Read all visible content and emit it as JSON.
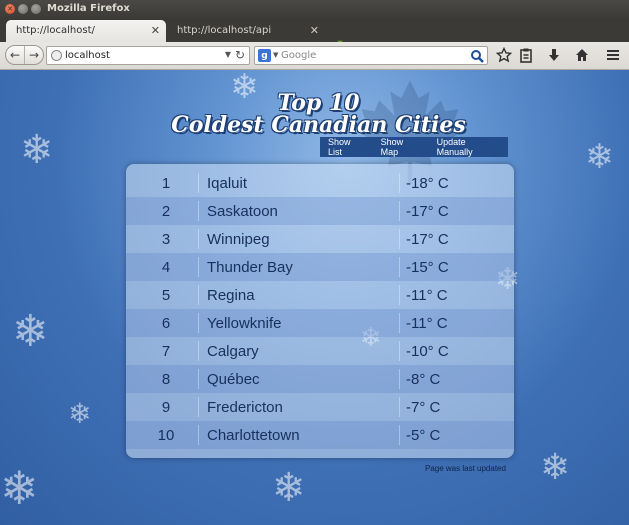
{
  "window": {
    "title": "Mozilla Firefox"
  },
  "tabs": [
    {
      "label": "http://localhost/",
      "active": true
    },
    {
      "label": "http://localhost/api",
      "active": false
    }
  ],
  "navbar": {
    "url": "localhost",
    "search_placeholder": "Google"
  },
  "page": {
    "title_line1": "Top 10",
    "title_line2": "Coldest Canadian Cities",
    "actions": [
      "Show List",
      "Show Map",
      "Update Manually"
    ],
    "cities": [
      {
        "rank": "1",
        "name": "Iqaluit",
        "temp": "-18° C"
      },
      {
        "rank": "2",
        "name": "Saskatoon",
        "temp": "-17° C"
      },
      {
        "rank": "3",
        "name": "Winnipeg",
        "temp": "-17° C"
      },
      {
        "rank": "4",
        "name": "Thunder Bay",
        "temp": "-15° C"
      },
      {
        "rank": "5",
        "name": "Regina",
        "temp": "-11° C"
      },
      {
        "rank": "6",
        "name": "Yellowknife",
        "temp": "-11° C"
      },
      {
        "rank": "7",
        "name": "Calgary",
        "temp": "-10° C"
      },
      {
        "rank": "8",
        "name": "Québec",
        "temp": "-8° C"
      },
      {
        "rank": "9",
        "name": "Fredericton",
        "temp": "-7° C"
      },
      {
        "rank": "10",
        "name": "Charlottetown",
        "temp": "-5° C"
      }
    ],
    "footer": "Page was last updated"
  },
  "colors": {
    "accent": "#234d8a",
    "background": "#4a7cc0"
  }
}
